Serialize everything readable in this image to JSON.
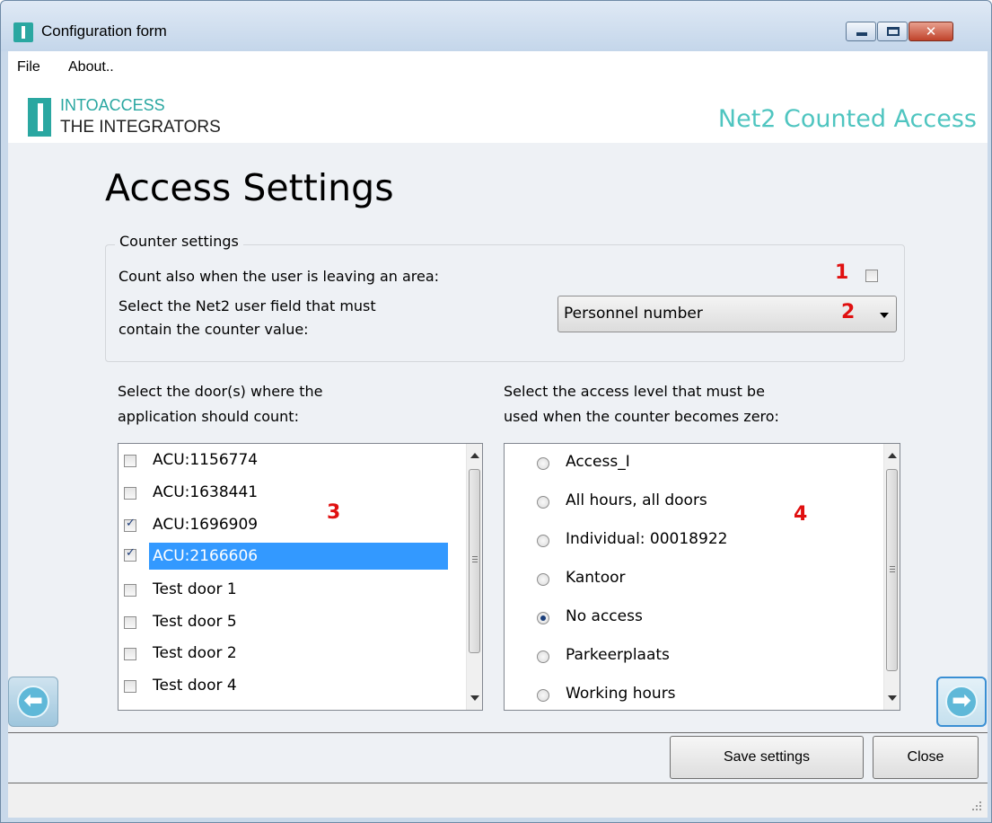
{
  "window": {
    "title": "Configuration form"
  },
  "menu": {
    "items": [
      "File",
      "About.."
    ]
  },
  "brand": {
    "logo_line1": "INTOACCESS",
    "logo_line2": "THE INTEGRATORS",
    "product_title": "Net2 Counted Access"
  },
  "page": {
    "title": "Access Settings"
  },
  "counter_settings": {
    "legend": "Counter settings",
    "count_leaving_label": "Count also when the user is leaving an area:",
    "count_leaving_checked": false,
    "user_field_label_line1": "Select the Net2 user field that must",
    "user_field_label_line2": "contain the counter value:",
    "user_field_value": "Personnel number"
  },
  "annotations": {
    "a1": "1",
    "a2": "2",
    "a3": "3",
    "a4": "4"
  },
  "doors": {
    "label_line1": "Select the door(s) where the",
    "label_line2": "application should count:",
    "items": [
      {
        "label": "ACU:1156774",
        "checked": false,
        "selected": false
      },
      {
        "label": "ACU:1638441",
        "checked": false,
        "selected": false
      },
      {
        "label": "ACU:1696909",
        "checked": true,
        "selected": false
      },
      {
        "label": "ACU:2166606",
        "checked": true,
        "selected": true
      },
      {
        "label": "Test door 1",
        "checked": false,
        "selected": false
      },
      {
        "label": "Test door 5",
        "checked": false,
        "selected": false
      },
      {
        "label": "Test door 2",
        "checked": false,
        "selected": false
      },
      {
        "label": "Test door 4",
        "checked": false,
        "selected": false
      }
    ]
  },
  "access_levels": {
    "label_line1": "Select the access level that must be",
    "label_line2": "used when the counter becomes zero:",
    "items": [
      {
        "label": "Access_I",
        "selected": false
      },
      {
        "label": "All hours, all doors",
        "selected": false
      },
      {
        "label": "Individual: 00018922",
        "selected": false
      },
      {
        "label": "Kantoor",
        "selected": false
      },
      {
        "label": "No access",
        "selected": true
      },
      {
        "label": "Parkeerplaats",
        "selected": false
      },
      {
        "label": "Working hours",
        "selected": false
      }
    ]
  },
  "buttons": {
    "save": "Save settings",
    "close": "Close"
  },
  "colors": {
    "accent": "#2aa7a1",
    "product_title": "#4fc5c0",
    "selection": "#3399ff",
    "annotation": "#e01010"
  },
  "icons": {
    "back": "arrow-left-icon",
    "next": "arrow-right-icon",
    "app": "intoaccess-logo-icon"
  }
}
